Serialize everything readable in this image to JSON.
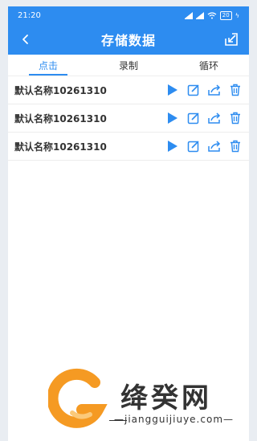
{
  "status_bar": {
    "time": "21:20",
    "battery": "20"
  },
  "header": {
    "title": "存储数据"
  },
  "tabs": [
    {
      "label": "点击",
      "active": true
    },
    {
      "label": "录制",
      "active": false
    },
    {
      "label": "循环",
      "active": false
    }
  ],
  "items": [
    {
      "name": "默认名称10261310"
    },
    {
      "name": "默认名称10261310"
    },
    {
      "name": "默认名称10261310"
    }
  ],
  "watermark": {
    "brand": "绛癸网",
    "url": "—jiangguijiuye.com—"
  },
  "colors": {
    "primary": "#2d8cf0",
    "text": "#333333",
    "orange": "#f59a23"
  },
  "icons": [
    "back-icon",
    "export-icon",
    "play-icon",
    "edit-icon",
    "share-icon",
    "delete-icon"
  ]
}
